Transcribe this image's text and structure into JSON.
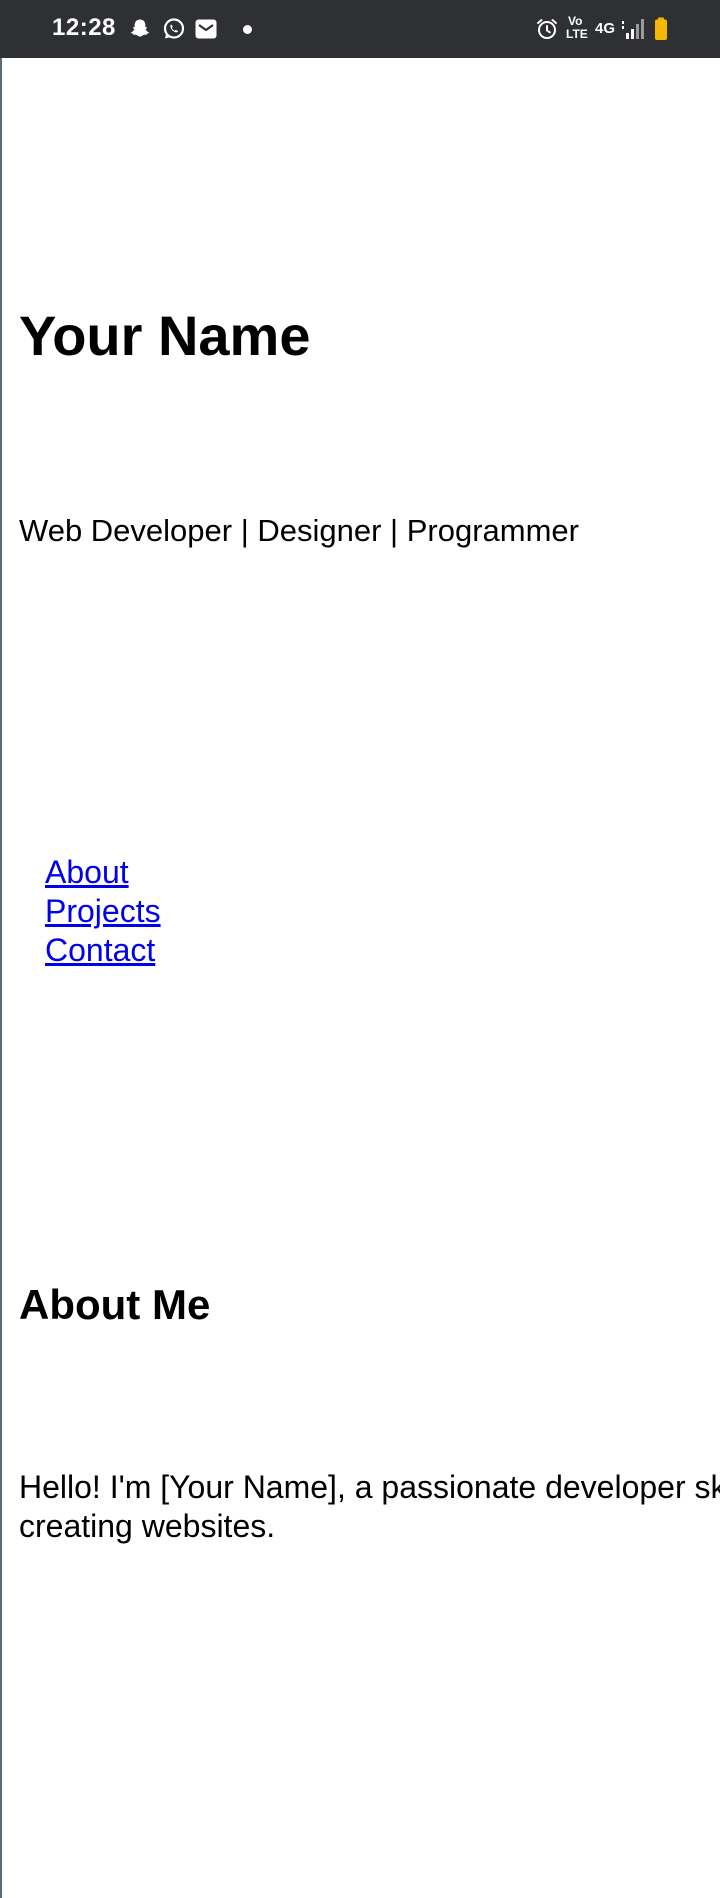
{
  "status_bar": {
    "time": "12:28",
    "left_icons": [
      "snapchat-icon",
      "whatsapp-icon",
      "gmail-icon",
      "notification-dot"
    ],
    "right_icons": [
      "alarm-icon",
      "volte-icon",
      "network-4g",
      "signal-icon",
      "battery-icon"
    ],
    "volte_label_top": "Vo",
    "volte_label_bottom": "LTE",
    "network_label": "4G",
    "battery_color": "#f5b800"
  },
  "header": {
    "title": "Your Name",
    "tagline": "Web Developer | Designer | Programmer"
  },
  "nav": {
    "items": [
      {
        "label": "About"
      },
      {
        "label": "Projects"
      },
      {
        "label": "Contact"
      }
    ]
  },
  "about": {
    "heading": "About Me",
    "text": "Hello! I'm [Your Name], a passionate developer skilled in creating websites."
  },
  "colors": {
    "status_bar_bg": "#2e3034",
    "link": "#0000ee",
    "text": "#000000"
  }
}
